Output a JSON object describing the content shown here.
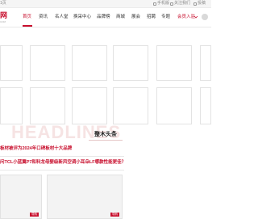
{
  "topbar": {
    "left_text": "1页",
    "links": [
      "手机版",
      "关注我们",
      "投稿"
    ]
  },
  "header": {
    "logo_text": "网",
    "logo_sub": "COM",
    "nav": [
      "首页",
      "资讯",
      "名人堂",
      "换采中心",
      "品牌榜",
      "商城",
      "展会",
      "招聘",
      "专题",
      "会员入驻"
    ],
    "active": "首页"
  },
  "section": {
    "watermark": "HEADLINES",
    "title": "整木头条"
  },
  "headlines": [
    "板材被评为2024年口碑板材十大品牌",
    "问TCL小蓝翼P7和科龙母婴级新风空调小耳朵LF哪款性能更佳？"
  ],
  "tiles": [
    {
      "tag": "导购"
    },
    {
      "tag": "导购"
    }
  ],
  "colors": {
    "accent": "#c8102e",
    "border": "#e3e3e3",
    "background": "#ffffff"
  },
  "icons": {
    "nav_dropdown": "chevron-down-icon",
    "user": "user-avatar-icon",
    "mobile": "mobile-icon",
    "follow": "follow-icon",
    "post": "edit-icon"
  }
}
